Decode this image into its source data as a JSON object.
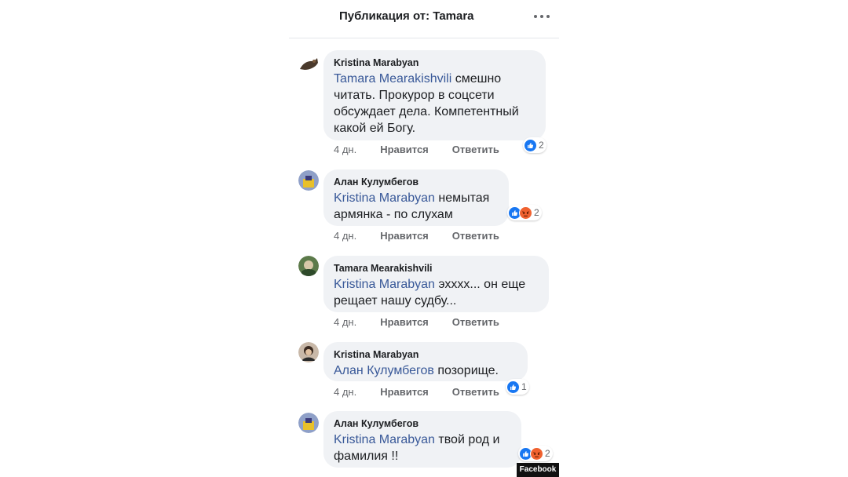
{
  "header": {
    "title": "Публикация от: Tamara",
    "more_icon": "more-horizontal-icon"
  },
  "comments": [
    {
      "author": "Kristina Marabyan",
      "mention": "Tamara Mearakishvili",
      "text": " смешно\nчитать. Прокурор в соцсети\nобсуждает дела. Компетентный\nкакой ей Богу.",
      "time": "4 дн.",
      "like": "Нравится",
      "reply": "Ответить",
      "reaction_count": "2",
      "reactions": [
        "like"
      ]
    },
    {
      "author": "Алан Кулумбегов",
      "mention": "Kristina Marabyan",
      "text": " немытая\nармянка - по слухам",
      "time": "4 дн.",
      "like": "Нравится",
      "reply": "Ответить",
      "reaction_count": "2",
      "reactions": [
        "like",
        "angry"
      ]
    },
    {
      "author": "Tamara Mearakishvili",
      "mention": "Kristina Marabyan",
      "text": " эхххх... он еще\nрещает нашу судбу...",
      "time": "4 дн.",
      "like": "Нравится",
      "reply": "Ответить",
      "reaction_count": "",
      "reactions": []
    },
    {
      "author": "Kristina Marabyan",
      "mention": "Алан Кулумбегов",
      "text": "  позорище.",
      "time": "4 дн.",
      "like": "Нравится",
      "reply": "Ответить",
      "reaction_count": "1",
      "reactions": [
        "like"
      ]
    },
    {
      "author": "Алан Кулумбегов",
      "mention": "Kristina Marabyan",
      "text": " твой род и\nфамилия !!",
      "time": "",
      "like": "",
      "reply": "",
      "reaction_count": "2",
      "reactions": [
        "like",
        "angry"
      ]
    }
  ],
  "watermark": "Facebook",
  "colors": {
    "mention": "#385898",
    "bubble": "#f0f2f5",
    "like": "#1877f2",
    "angry": "#f0612f"
  }
}
